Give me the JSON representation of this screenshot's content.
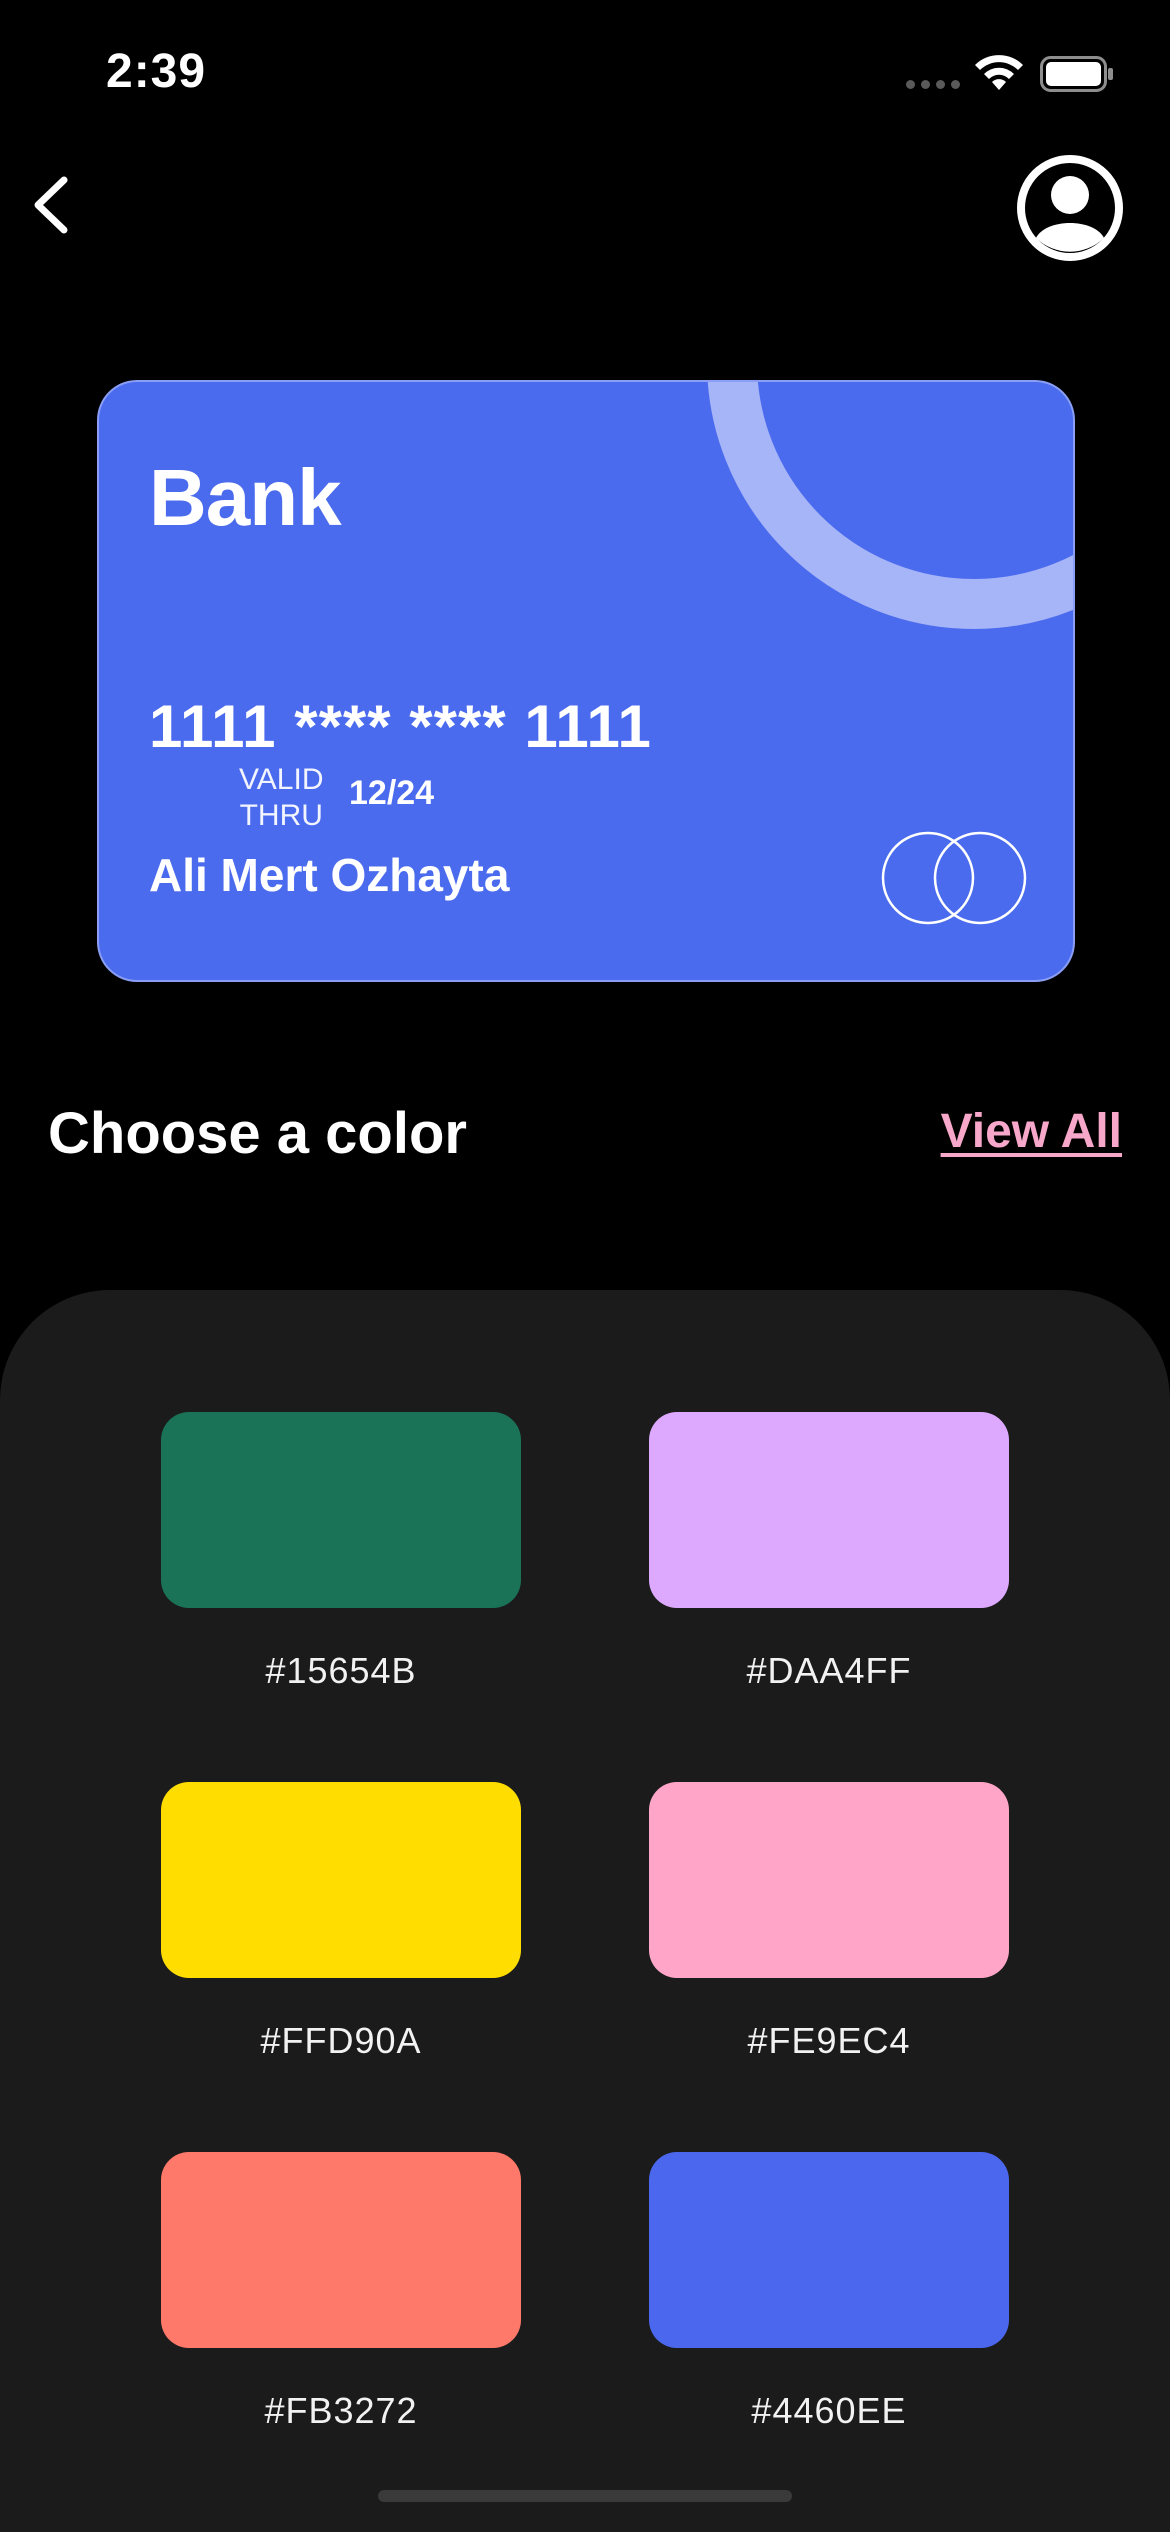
{
  "status_bar": {
    "time": "2:39"
  },
  "card": {
    "bank_name": "Bank",
    "number": "1111 **** **** 1111",
    "valid_line1": "VALID",
    "valid_line2": "THRU",
    "expiry": "12/24",
    "holder": "Ali Mert Ozhayta",
    "color": "#4B6BEE"
  },
  "section": {
    "title": "Choose a color",
    "view_all": "View All",
    "view_all_color": "#F7A7C9"
  },
  "swatches": [
    {
      "label": "#15654B",
      "color": "#1A7356"
    },
    {
      "label": "#DAA4FF",
      "color": "#DCA9FE"
    },
    {
      "label": "#FFD90A",
      "color": "#FFDD00"
    },
    {
      "label": "#FE9EC4",
      "color": "#FFA6C8"
    },
    {
      "label": "#FB3272",
      "color": "#FF796A"
    },
    {
      "label": "#4460EE",
      "color": "#4B67EE"
    }
  ],
  "icons": {
    "back": "chevron-left-icon",
    "profile": "user-circle-icon",
    "wifi": "wifi-icon",
    "battery": "battery-icon",
    "card_network": "card-network-logo-icon"
  }
}
